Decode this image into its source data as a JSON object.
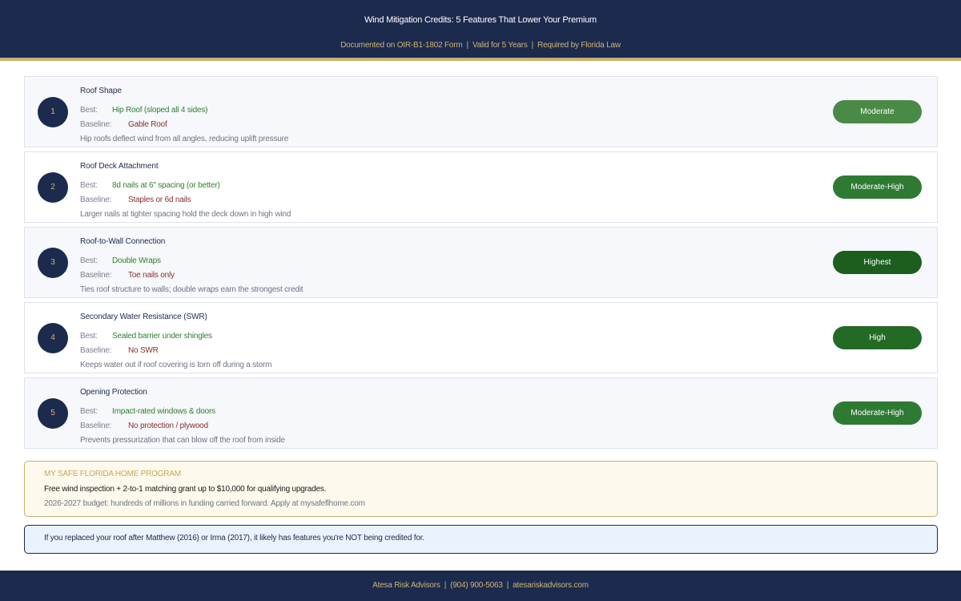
{
  "header": {
    "title": "Wind Mitigation Credits: 5 Features That Lower Your Premium",
    "subtitle_items": [
      "Documented on OIR-B1-1802 Form",
      "Valid for 5 Years",
      "Required by Florida Law"
    ],
    "separator": "|"
  },
  "best_label": "Best:",
  "baseline_label": "Baseline:",
  "features": [
    {
      "number": "1",
      "title": "Roof Shape",
      "best": "Hip Roof (sloped all 4 sides)",
      "baseline": "Gable Roof",
      "description": "Hip roofs deflect wind from all angles, reducing uplift pressure",
      "impact": "Moderate"
    },
    {
      "number": "2",
      "title": "Roof Deck Attachment",
      "best": "8d nails at 6\" spacing (or better)",
      "baseline": "Staples or 6d nails",
      "description": "Larger nails at tighter spacing hold the deck down in high wind",
      "impact": "Moderate-High"
    },
    {
      "number": "3",
      "title": "Roof-to-Wall Connection",
      "best": "Double Wraps",
      "baseline": "Toe nails only",
      "description": "Ties roof structure to walls; double wraps earn the strongest credit",
      "impact": "Highest"
    },
    {
      "number": "4",
      "title": "Secondary Water Resistance (SWR)",
      "best": "Sealed barrier under shingles",
      "baseline": "No SWR",
      "description": "Keeps water out if roof covering is torn off during a storm",
      "impact": "High"
    },
    {
      "number": "5",
      "title": "Opening Protection",
      "best": "Impact-rated windows & doors",
      "baseline": "No protection / plywood",
      "description": "Prevents pressurization that can blow off the roof from inside",
      "impact": "Moderate-High"
    }
  ],
  "impact_colors": {
    "Moderate": "#4a8a47",
    "Moderate-High": "#2f7a33",
    "High": "#236b25",
    "Highest": "#1c5e1e"
  },
  "grant": {
    "heading": "MY SAFE FLORIDA HOME PROGRAM",
    "line1": "Free wind inspection + 2-to-1 matching grant up to $10,000 for qualifying upgrades.",
    "line2": "2026-2027 budget: hundreds of millions in funding carried forward. Apply at mysafeflhome.com"
  },
  "note": {
    "text": "If you replaced your roof after Matthew (2016) or Irma (2017), it likely has features you're NOT being credited for."
  },
  "footer": {
    "items": [
      "Atesa Risk Advisors",
      "(904) 900-5063",
      "atesariskadvisors.com"
    ],
    "separator": "|"
  },
  "colors": {
    "navy": "#1c2a4e",
    "gold": "#c8b06e",
    "best_green": "#2f7f2f",
    "baseline_red": "#8a2e2e"
  }
}
